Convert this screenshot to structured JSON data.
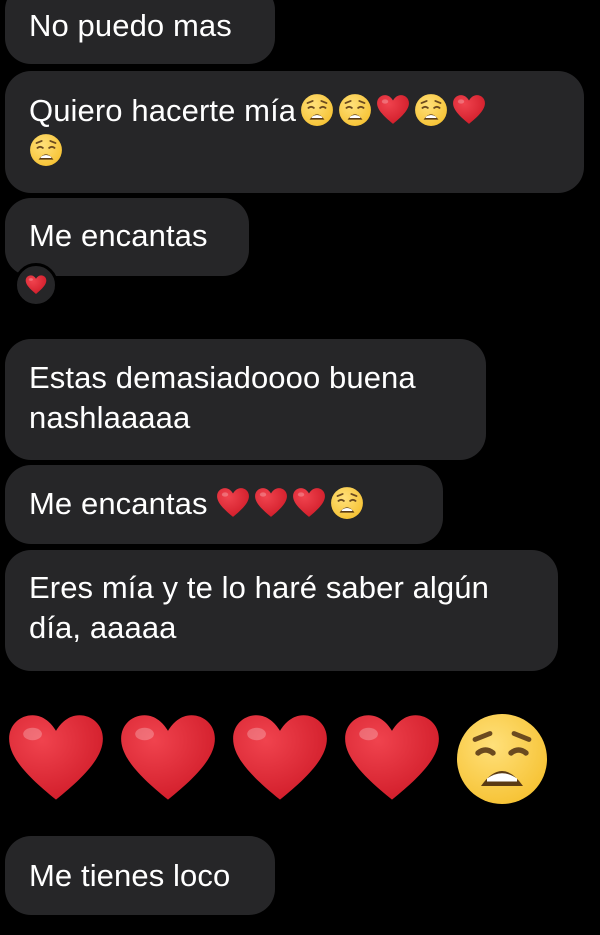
{
  "messages": [
    {
      "text": "No puedo mas"
    },
    {
      "text": "Quiero hacerte mía",
      "emojis": [
        "weary-face",
        "weary-face",
        "red-heart",
        "weary-face",
        "red-heart",
        "weary-face"
      ]
    },
    {
      "text": "Me encantas",
      "reaction": "red-heart"
    },
    {
      "text": "Estas demasiadoooo buena\nnashlaaaaa"
    },
    {
      "text": "Me encantas",
      "emojis": [
        "red-heart",
        "red-heart",
        "red-heart",
        "weary-face"
      ]
    },
    {
      "text": "Eres mía y te lo haré saber algún\ndía, aaaaa"
    },
    {
      "emoji_only": [
        "red-heart",
        "red-heart",
        "red-heart",
        "red-heart",
        "weary-face"
      ]
    },
    {
      "text": "Me tienes loco"
    }
  ],
  "colors": {
    "background": "#000000",
    "bubble": "#262628",
    "text": "#ffffff",
    "heart": "#d11d2a",
    "weary": "#f6c233"
  }
}
